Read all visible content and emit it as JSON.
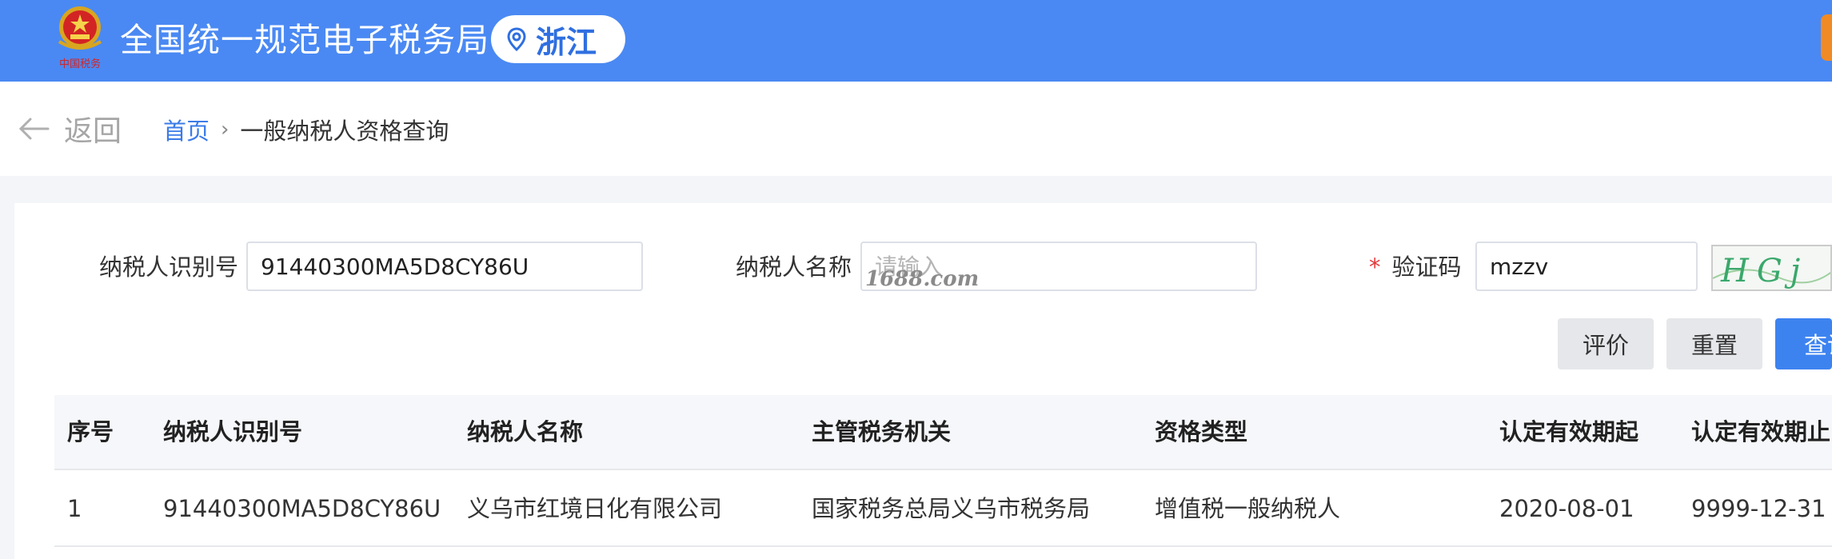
{
  "header": {
    "emblem_caption": "中国税务",
    "site_title": "全国统一规范电子税务局",
    "region": "浙江",
    "colors": {
      "bar": "#4a89f3",
      "accent": "#f08a24"
    }
  },
  "nav": {
    "back_label": "返回",
    "breadcrumb_home": "首页",
    "breadcrumb_sep": "›",
    "breadcrumb_current": "一般纳税人资格查询"
  },
  "form": {
    "taxpayer_id_label": "纳税人识别号",
    "taxpayer_id_value": "91440300MA5D8CY86U",
    "taxpayer_name_label": "纳税人名称",
    "taxpayer_name_value": "",
    "taxpayer_name_placeholder": "请输入",
    "watermark": "1688.com",
    "captcha_required_mark": "*",
    "captcha_label": "验证码",
    "captcha_value": "mzzv",
    "captcha_image_text": "HGj"
  },
  "actions": {
    "rate_label": "评价",
    "reset_label": "重置",
    "query_label": "查询"
  },
  "table": {
    "columns": [
      "序号",
      "纳税人识别号",
      "纳税人名称",
      "主管税务机关",
      "资格类型",
      "认定有效期起",
      "认定有效期止"
    ],
    "rows": [
      [
        "1",
        "91440300MA5D8CY86U",
        "义乌市红境日化有限公司",
        "国家税务总局义乌市税务局",
        "增值税一般纳税人",
        "2020-08-01",
        "9999-12-31"
      ]
    ]
  }
}
